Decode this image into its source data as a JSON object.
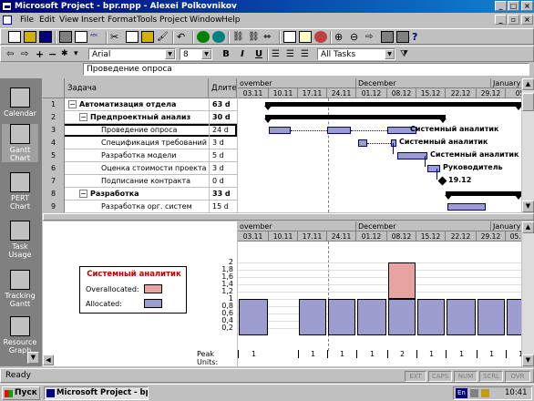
{
  "window": {
    "title": "Microsoft Project - bpr.mpp - Alexei Polkovnikov"
  },
  "menu": [
    "File",
    "Edit",
    "View",
    "Insert",
    "Format",
    "Tools",
    "Project",
    "Window",
    "Help"
  ],
  "formatting": {
    "font": "Arial",
    "size": "8",
    "bold": "B",
    "italic": "I",
    "underline": "U",
    "filter": "All Tasks"
  },
  "entry_bar": {
    "value": "Проведение опроса"
  },
  "view_bar": [
    {
      "label": "Calendar",
      "icon": "calendar-icon"
    },
    {
      "label": "Gantt Chart",
      "icon": "gantt-chart-icon"
    },
    {
      "label": "PERT Chart",
      "icon": "pert-chart-icon"
    },
    {
      "label": "Task Usage",
      "icon": "task-usage-icon"
    },
    {
      "label": "Tracking Gantt",
      "icon": "tracking-gantt-icon"
    },
    {
      "label": "Resource Graph",
      "icon": "resource-graph-icon"
    }
  ],
  "table": {
    "col_task": "Задача",
    "col_duration": "Длител",
    "rows": [
      {
        "id": "1",
        "name": "Автоматизация отдела",
        "duration": "63 d",
        "level": 0,
        "summary": true,
        "sym": "−"
      },
      {
        "id": "2",
        "name": "Предпроектный анализ",
        "duration": "30 d",
        "level": 1,
        "summary": true,
        "sym": "−"
      },
      {
        "id": "3",
        "name": "Проведение опроса",
        "duration": "24 d",
        "level": 2,
        "summary": false,
        "sym": ""
      },
      {
        "id": "4",
        "name": "Спецификация требований",
        "duration": "3 d",
        "level": 2,
        "summary": false,
        "sym": ""
      },
      {
        "id": "5",
        "name": "Разработка модели",
        "duration": "5 d",
        "level": 2,
        "summary": false,
        "sym": ""
      },
      {
        "id": "6",
        "name": "Оценка стоимости проекта",
        "duration": "3 d",
        "level": 2,
        "summary": false,
        "sym": ""
      },
      {
        "id": "7",
        "name": "Подписание контракта",
        "duration": "0 d",
        "level": 2,
        "summary": false,
        "sym": ""
      },
      {
        "id": "8",
        "name": "Разработка",
        "duration": "33 d",
        "level": 1,
        "summary": true,
        "sym": "−"
      },
      {
        "id": "9",
        "name": "Разработка орг. систем",
        "duration": "15 d",
        "level": 2,
        "summary": false,
        "sym": ""
      }
    ]
  },
  "timescale": {
    "months_top": [
      "ovember",
      "December",
      "January"
    ],
    "weeks_top": [
      "03.11",
      "10.11",
      "17.11",
      "24.11",
      "01.12",
      "08.12",
      "15.12",
      "22.12",
      "29.12",
      "05"
    ],
    "months_bottom": [
      "ovember",
      "December",
      "January"
    ],
    "weeks_bottom": [
      "03.11",
      "10.11",
      "17.11",
      "24.11",
      "01.12",
      "08.12",
      "15.12",
      "22.12",
      "29.12",
      "05.01"
    ]
  },
  "gantt_labels": {
    "r3": "Системный аналитик",
    "r4": "Системный аналитик",
    "r5": "Системный аналитик",
    "r6": "Руководитель",
    "r7": "19.12"
  },
  "legend": {
    "resource": "Системный аналитик",
    "overallocated": "Overallocated:",
    "allocated": "Allocated:",
    "overallocated_color": "#e8a4a0",
    "allocated_color": "#9c9cce"
  },
  "graph": {
    "y_ticks": [
      "2",
      "1,8",
      "1,6",
      "1,4",
      "1,2",
      "1",
      "0,8",
      "0,6",
      "0,4",
      "0,2"
    ],
    "peak_label": "Peak Units:",
    "peak_units": [
      "1",
      "",
      "1",
      "1",
      "1",
      "2",
      "1",
      "1",
      "1",
      "1"
    ],
    "allocated": [
      1,
      0,
      1,
      1,
      1,
      1,
      1,
      1,
      1,
      1
    ],
    "overallocated": [
      0,
      0,
      0,
      0,
      0,
      1,
      0,
      0,
      0,
      0
    ]
  },
  "status": {
    "text": "Ready",
    "indicators": [
      "EXT",
      "CAPS",
      "NUM",
      "SCRL",
      "OVR"
    ]
  },
  "taskbar": {
    "start": "Пуск",
    "task": "Microsoft Project - bp...",
    "lang": "En",
    "clock": "10:41"
  }
}
